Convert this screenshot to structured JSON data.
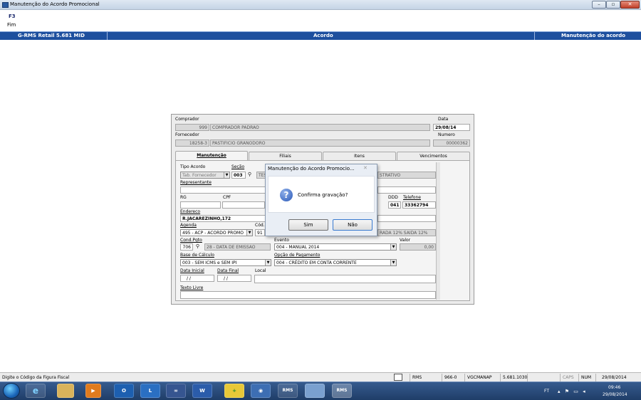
{
  "window": {
    "title": "Manutenção do Acordo Promocional"
  },
  "shortcuts": {
    "key": "F3",
    "label": "Fim"
  },
  "header": {
    "left": "G-RMS Retail 5.681 MID",
    "center": "Acordo",
    "right": "Manutenção do acordo"
  },
  "form": {
    "comprador_label": "Comprador",
    "comprador_code": "999",
    "comprador_name": "COMPRADOR PADRAO",
    "data_label": "Data",
    "data_value": "29/08/14",
    "fornecedor_label": "Fornecedor",
    "fornecedor_code": "18258-3",
    "fornecedor_name": "PASTIFICIO GRANODORO",
    "numero_label": "Numero",
    "numero_value": "00000362",
    "tabs": [
      "Manutenção",
      "Filiais",
      "Itens",
      "Vencimentos"
    ],
    "tipo_acordo_label": "Tipo Acordo",
    "tipo_acordo_value": "Tab. Fornecedor",
    "secao_label": "Seção",
    "secao_code": "003",
    "secao_name_start": "TES",
    "secao_name_end": "STRATIVO",
    "representante_label": "Representante",
    "rg_label": "RG",
    "cpf_label": "CPF",
    "ddd_label": "DDD",
    "ddd_value": "041",
    "telefone_label": "Telefone",
    "telefone_value": "33362794",
    "endereco_label": "Endereco",
    "endereco_value": "R.JACAREZINHO,172",
    "agenda_label": "Agenda",
    "agenda_value": "495 - ACP - ACORDO PROMO",
    "cod_label": "Cód.",
    "cod_value": "91",
    "cod_desc": "RADA 12% SAIDA 12%",
    "cond_pgto_label": "Cond.Pgto",
    "cond_pgto_code": "706",
    "cond_pgto_desc": "28 - DATA DE EMISSAO",
    "evento_label": "Evento",
    "evento_value": "004 - MANUAL 2014",
    "valor_label": "Valor",
    "valor_value": "0,00",
    "base_calculo_label": "Base de Cálculo",
    "base_calculo_value": "003 - SEM ICMS e SEM IPI",
    "opcao_pagamento_label": "Opção de Pagamento",
    "opcao_pagamento_value": "004 - CRÉDITO EM CONTA CORRENTE",
    "data_inicial_label": "Data Inicial",
    "data_inicial_value": "/ /",
    "data_final_label": "Data Final",
    "data_final_value": "/ /",
    "local_label": "Local",
    "texto_livre_label": "Texto Livre"
  },
  "dialog": {
    "title": "Manutenção do Acordo Promocio...",
    "message": "Confirma gravação?",
    "yes": "Sim",
    "no": "Não"
  },
  "statusbar": {
    "message": "Digite o Código da Figura Fiscal",
    "system": "RMS",
    "store": "966-0",
    "user": "VGCMANAP",
    "version": "5.681.1030",
    "caps": "CAPS",
    "num": "NUM",
    "date": "29/08/2014"
  },
  "taskbar": {
    "apps": [
      "IE",
      "Explorer",
      "Media",
      "Outlook",
      "Lync",
      "Conference",
      "Word",
      "Tool",
      "Remote",
      "RMS",
      "Window",
      "RMS"
    ],
    "tray_lang": "FT",
    "time": "09:46",
    "date": "29/08/2014"
  }
}
